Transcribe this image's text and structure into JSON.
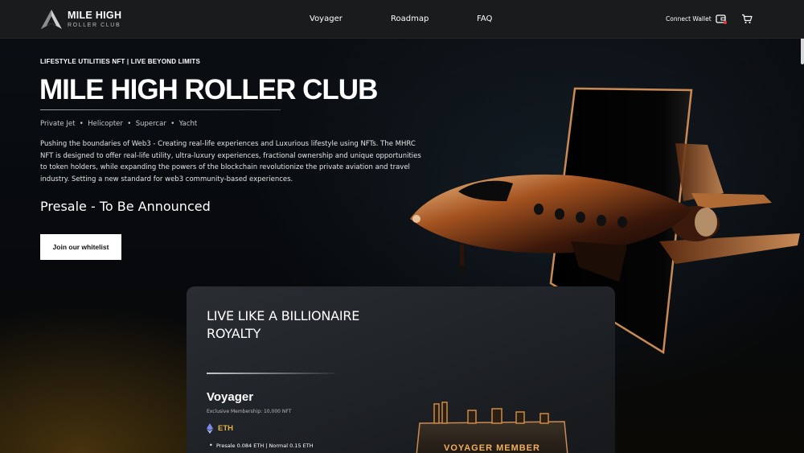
{
  "header": {
    "logo_title": "MILE HIGH",
    "logo_subtitle": "ROLLER CLUB",
    "nav": [
      "Voyager",
      "Roadmap",
      "FAQ"
    ],
    "connect_wallet": "Connect Wallet",
    "icons": [
      "wallet-icon",
      "cart-icon"
    ]
  },
  "hero": {
    "eyebrow": "LIFESTYLE UTILITIES NFT | LIVE BEYOND LIMITS",
    "title": "MILE HIGH ROLLER CLUB",
    "vehicles": "Private Jet  •  Helicopter  •  Supercar  •  Yacht",
    "description": "Pushing the boundaries of Web3 - Creating real-life experiences and Luxurious lifestyle using NFTs. The MHRC NFT is designed to offer real-life utility, ultra-luxury experiences, fractional ownership and unique opportunities to token holders, while expanding the powers of the blockchain revolutionize the private aviation and travel industry. Setting a new standard for web3 community-based experiences.",
    "presale": "Presale - To Be Announced",
    "cta": "Join our whitelist"
  },
  "card": {
    "heading": "LIVE LIKE A BILLIONAIRE ROYALTY",
    "name": "Voyager",
    "membership": "Exclusive Membership: 10,000 NFT",
    "currency": "ETH",
    "price": "Presale 0.084 ETH | Normal 0.15 ETH",
    "badge_text": "VOYAGER MEMBER"
  },
  "colors": {
    "accent_gold": "#e6b24a",
    "header_bg": "#1a1b1d",
    "card_bg": "#23272b"
  }
}
